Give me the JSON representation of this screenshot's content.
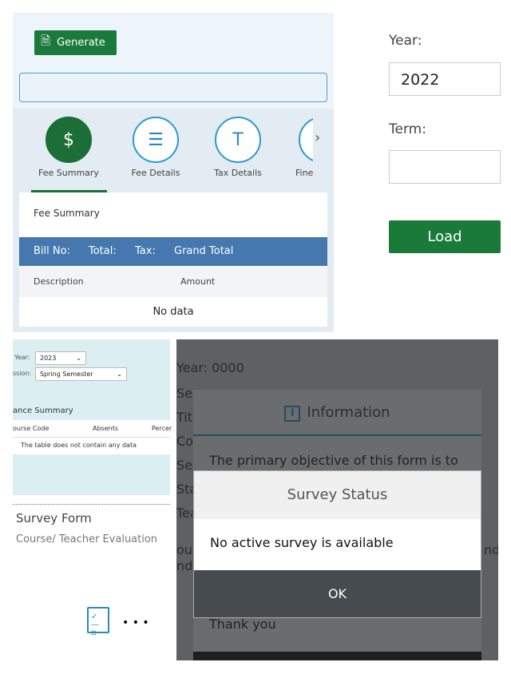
{
  "fee_panel": {
    "generate_label": "Generate",
    "tabs": [
      {
        "label": "Fee Summary",
        "active": true
      },
      {
        "label": "Fee Details"
      },
      {
        "label": "Tax Details"
      },
      {
        "label": "Fine"
      }
    ],
    "section_title": "Fee Summary",
    "header": [
      "Bill No:",
      "Total:",
      "Tax:",
      "Grand Total"
    ],
    "columns": [
      "Description",
      "Amount"
    ],
    "empty_text": "No data",
    "accent": "#1a6e36",
    "header_color": "#4578ae"
  },
  "load_panel": {
    "year_label": "Year:",
    "year_value": "2022",
    "term_label": "Term:",
    "term_value": "",
    "load_label": "Load"
  },
  "attendance_panel": {
    "year_label": "Year:",
    "year_value": "2023",
    "session_label": "ssion:",
    "session_value": "Spring Semester",
    "section_title": "ance Summary",
    "columns": [
      "ourse Code",
      "Absents",
      "Percer"
    ],
    "empty_text": "The table does not contain any data",
    "survey_title": "Survey Form",
    "survey_subtitle": "Course/ Teacher Evaluation",
    "more": "• • •"
  },
  "survey_panel": {
    "background_lines": [
      "Year: 0000",
      "Ses",
      "Titl",
      "Co",
      "Se",
      "Sta",
      "Tea",
      "ou",
      "nd"
    ],
    "background_right": "nd",
    "info_title": "Information",
    "info_text": "The primary objective of this form is to",
    "info_footer": "Thank you",
    "dialog_title": "Survey Status",
    "dialog_message": "No active survey is available",
    "ok_label": "OK"
  }
}
